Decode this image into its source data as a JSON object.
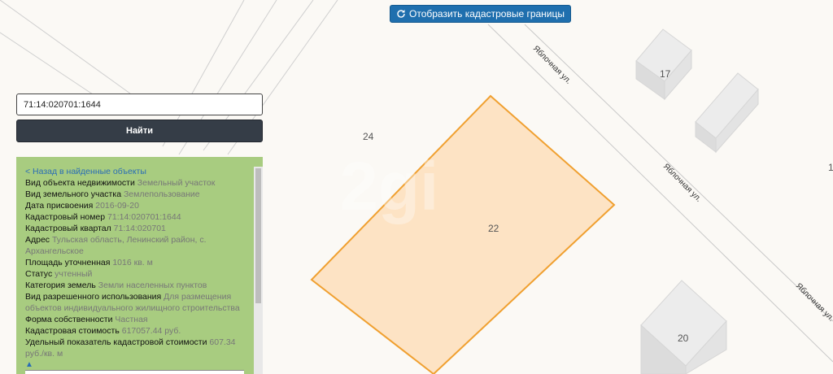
{
  "toolbar": {
    "show_cadastral_label": "Отобразить кадастровые границы",
    "refresh_icon": "refresh-icon"
  },
  "search": {
    "value": "71:14:020701:1644",
    "find_label": "Найти"
  },
  "info_panel": {
    "back_link": "< Назад в найденные объекты",
    "rows": [
      {
        "label": "Вид объекта недвижимости",
        "value": "Земельный участок"
      },
      {
        "label": "Вид земельного участка",
        "value": "Землепользование"
      },
      {
        "label": "Дата присвоения",
        "value": "2016-09-20"
      },
      {
        "label": "Кадастровый номер",
        "value": "71:14:020701:1644"
      },
      {
        "label": "Кадастровый квартал",
        "value": "71:14:020701"
      },
      {
        "label": "Адрес",
        "value": "Тульская область, Ленинский район, с. Архангельское"
      },
      {
        "label": "Площадь уточненная",
        "value": "1016 кв. м"
      },
      {
        "label": "Статус",
        "value": "учтенный"
      },
      {
        "label": "Категория земель",
        "value": "Земли населенных пунктов"
      },
      {
        "label": "Вид разрешенного использования",
        "value": "Для размещения объектов индивидуального жилищного строительства"
      },
      {
        "label": "Форма собственности",
        "value": "Частная"
      },
      {
        "label": "Кадастровая стоимость",
        "value": "617057.44 руб."
      },
      {
        "label": "Удельный показатель кадастровой стоимости",
        "value": "607.34 руб./кв. м"
      }
    ],
    "collapse_arrow": "▲"
  },
  "map": {
    "parcel_number": "22",
    "neighbor_number": "24",
    "house_17": "17",
    "house_20": "20",
    "edge_label": "1",
    "street_name": "Яблочная ул.",
    "watermark": "2gi",
    "parcel_fill": "#fde3c4",
    "parcel_stroke": "#f0a030"
  }
}
